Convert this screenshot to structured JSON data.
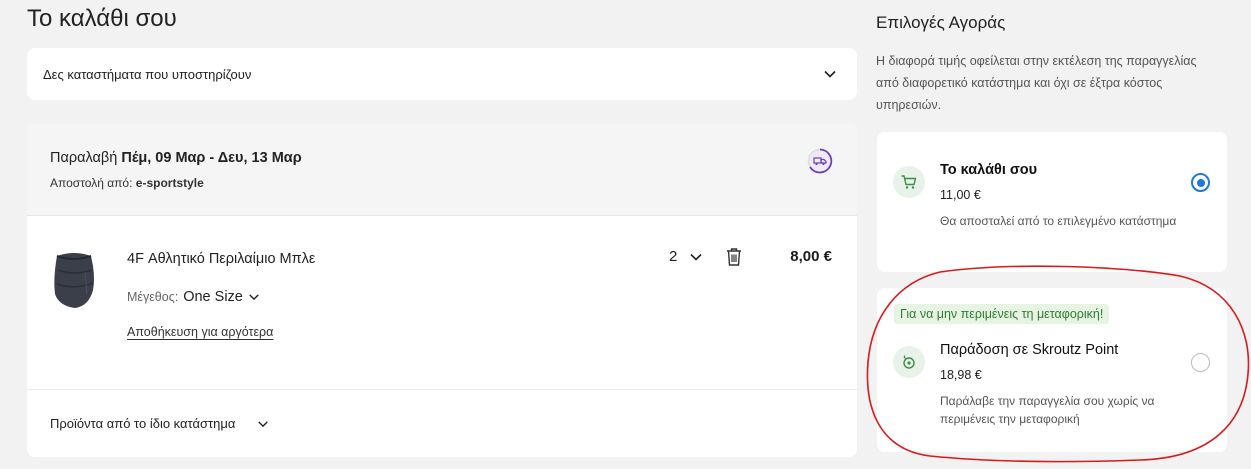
{
  "page": {
    "title": "Το καλάθι σου"
  },
  "stores": {
    "label": "Δες καταστήματα που υποστηρίζουν",
    "icon": "chevron-down-icon"
  },
  "order": {
    "pickup_prefix": "Παραλαβή",
    "pickup_dates": "Πέμ, 09 Μαρ - Δευ, 13 Μαρ",
    "shipfrom_prefix": "Αποστολή από:",
    "shipfrom_store": "e-sportstyle",
    "status_icon": "delivery-truck-icon",
    "product": {
      "name": "4F Αθλητικό Περιλαίμιο Μπλε",
      "size_label": "Μέγεθος:",
      "size_value": "One Size",
      "save_later": "Αποθήκευση για αργότερα",
      "quantity": "2",
      "price": "8,00 €",
      "image_icon": "neck-gaiter-image"
    },
    "same_store_label": "Προϊόντα από το ίδιο κατάστημα"
  },
  "sidebar": {
    "title": "Επιλογές Αγοράς",
    "note": "Η διαφορά τιμής οφείλεται στην εκτέλεση της παραγγελίας από διαφορετικό κατάστημα και όχι σε έξτρα κόστος υπηρεσιών.",
    "options": [
      {
        "title": "Το καλάθι σου",
        "price": "11,00 €",
        "desc": "Θα αποσταλεί από το επιλεγμένο κατάστημα",
        "icon": "cart-icon",
        "selected": true
      },
      {
        "badge": "Για να μην περιμένεις τη μεταφορική!",
        "title": "Παράδοση σε Skroutz Point",
        "price": "18,98 €",
        "desc": "Παράλαβε την παραγγελία σου χωρίς να περιμένεις την μεταφορική",
        "icon": "location-pin-icon",
        "selected": false
      }
    ]
  },
  "colors": {
    "background": "#f2f2f2",
    "radio_selected": "#1f7ad6",
    "promo_text": "#2e7d32",
    "annotation": "#d91a1a",
    "status_ring": "#6b3fb8"
  }
}
